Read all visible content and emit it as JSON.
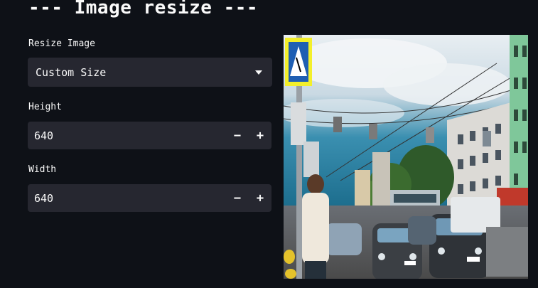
{
  "title": "--- Image resize ---",
  "resize": {
    "label": "Resize Image",
    "selected": "Custom Size"
  },
  "height": {
    "label": "Height",
    "value": "640",
    "minus": "−",
    "plus": "+"
  },
  "width": {
    "label": "Width",
    "value": "640",
    "minus": "−",
    "plus": "+"
  },
  "colors": {
    "background": "#0e1117",
    "input_bg": "#262730",
    "text": "#fafafa"
  }
}
